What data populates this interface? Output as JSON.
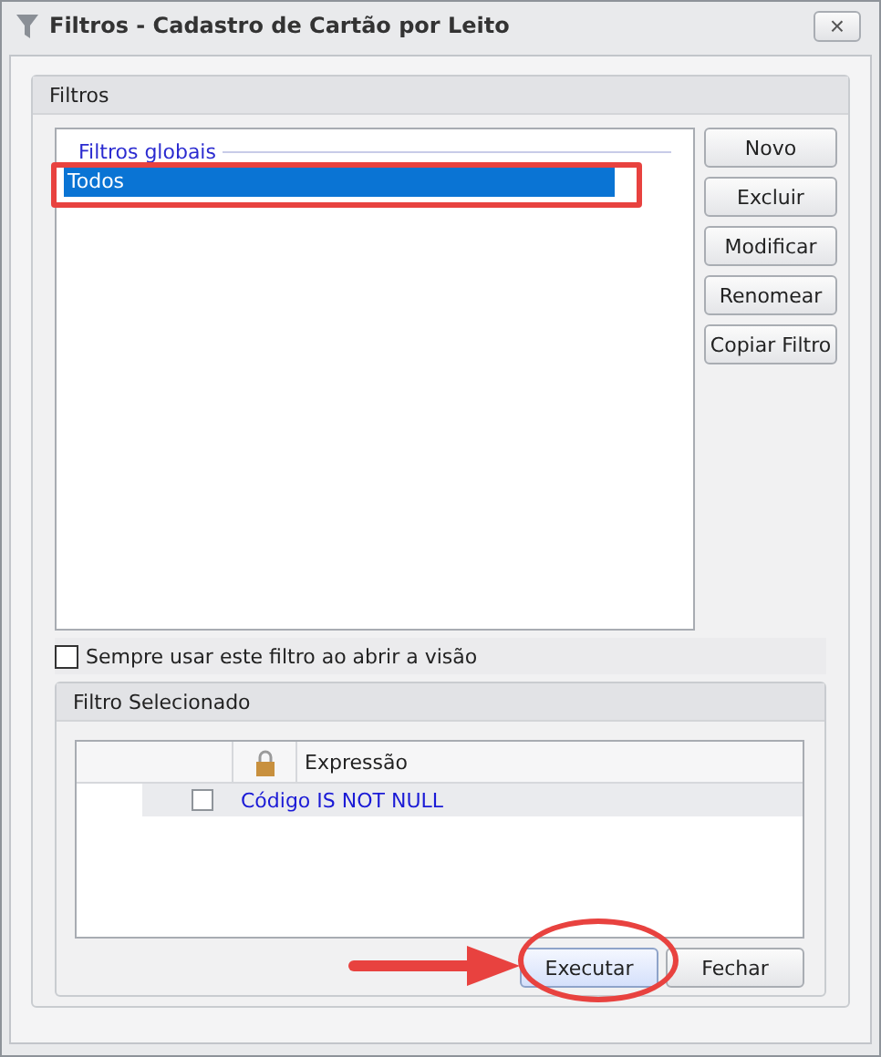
{
  "window": {
    "title": "Filtros - Cadastro de Cartão por Leito",
    "close": "×"
  },
  "filters_panel": {
    "title": "Filtros",
    "list_group": "Filtros globais",
    "items": [
      {
        "label": "Todos",
        "selected": true
      }
    ],
    "buttons": [
      "Novo",
      "Excluir",
      "Modificar",
      "Renomear",
      "Copiar Filtro"
    ]
  },
  "always_use": {
    "label": "Sempre usar este filtro ao abrir a visão",
    "checked": false
  },
  "selected_filter": {
    "title": "Filtro Selecionado",
    "columns": [
      "Expressão"
    ],
    "rows": [
      {
        "locked": false,
        "expression": "Código IS NOT NULL"
      }
    ]
  },
  "footer_buttons": [
    {
      "label": "Executar",
      "focused": true
    },
    {
      "label": "Fechar",
      "focused": false
    }
  ]
}
